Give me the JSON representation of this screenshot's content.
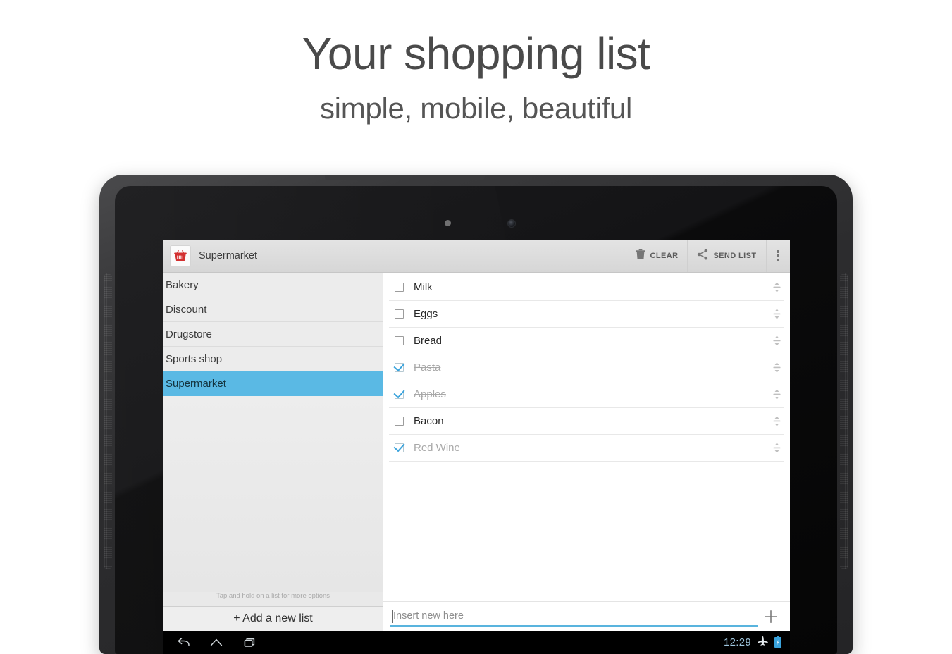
{
  "promo": {
    "title": "Your shopping list",
    "subtitle": "simple, mobile, beautiful"
  },
  "colors": {
    "accent_blue": "#5ab9e4",
    "check_blue": "#3aa3dc",
    "app_icon_red": "#d32f2f",
    "clock_blue": "#9fc6de"
  },
  "app": {
    "actionbar": {
      "icon": "shopping-basket-icon",
      "title": "Supermarket",
      "actions": [
        {
          "icon": "trash-icon",
          "label": "CLEAR"
        },
        {
          "icon": "share-icon",
          "label": "SEND LIST"
        }
      ],
      "overflow": "overflow-menu-icon"
    },
    "sidebar": {
      "lists": [
        {
          "label": "Bakery",
          "selected": false
        },
        {
          "label": "Discount",
          "selected": false
        },
        {
          "label": "Drugstore",
          "selected": false
        },
        {
          "label": "Sports shop",
          "selected": false
        },
        {
          "label": "Supermarket",
          "selected": true
        }
      ],
      "hint": "Tap and hold on a list for more options",
      "add_label": "+ Add a new list"
    },
    "items": [
      {
        "label": "Milk",
        "checked": false
      },
      {
        "label": "Eggs",
        "checked": false
      },
      {
        "label": "Bread",
        "checked": false
      },
      {
        "label": "Pasta",
        "checked": true
      },
      {
        "label": "Apples",
        "checked": true
      },
      {
        "label": "Bacon",
        "checked": false
      },
      {
        "label": "Red Wine",
        "checked": true
      }
    ],
    "new_item": {
      "value": "",
      "placeholder": "Insert new here",
      "add_icon": "plus-icon"
    }
  },
  "navbar": {
    "back": "back-icon",
    "home": "home-icon",
    "recents": "recents-icon",
    "clock": "12:29",
    "airplane": "airplane-mode-icon",
    "battery": "battery-charging-icon"
  }
}
